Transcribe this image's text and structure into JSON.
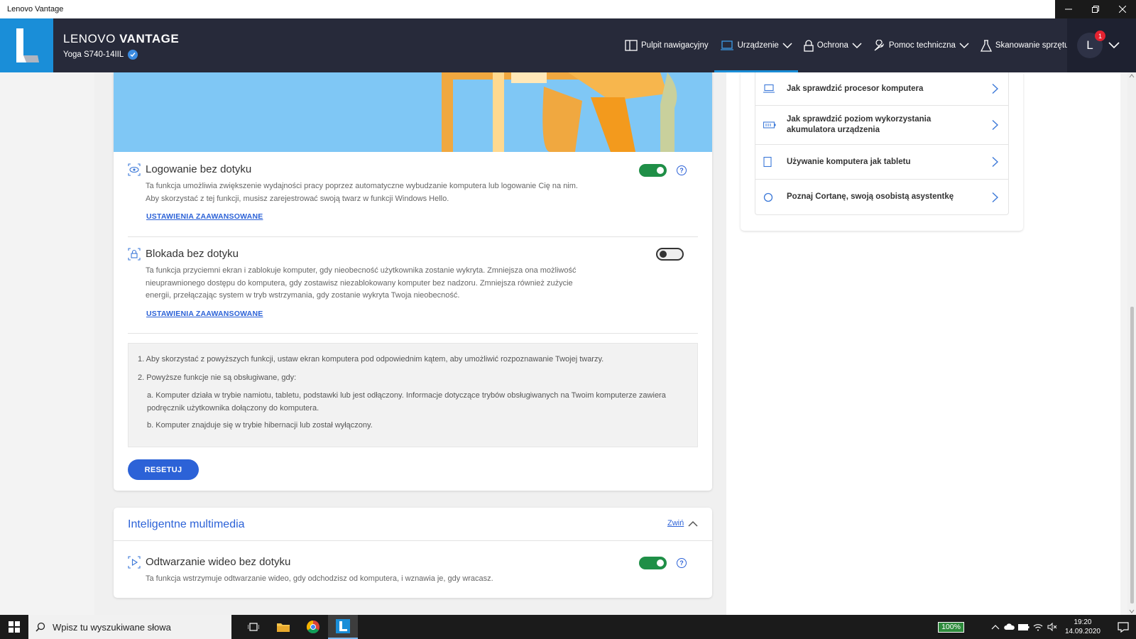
{
  "window": {
    "title": "Lenovo Vantage"
  },
  "brand": {
    "name_light": "LENOVO",
    "name_bold": "VANTAGE",
    "model": "Yoga S740-14IIL"
  },
  "nav": {
    "items": [
      {
        "label": "Pulpit nawigacyjny",
        "icon": "dashboard-icon"
      },
      {
        "label": "Urządzenie",
        "icon": "laptop-icon",
        "active": true
      },
      {
        "label": "Ochrona",
        "icon": "lock-icon"
      },
      {
        "label": "Pomoc techniczna",
        "icon": "wrench-icon"
      },
      {
        "label": "Skanowanie sprzętu",
        "icon": "flask-icon"
      }
    ],
    "user_initial": "L",
    "notification_count": "1"
  },
  "features": {
    "login": {
      "title": "Logowanie bez dotyku",
      "desc_line1": "Ta funkcja umożliwia zwiększenie wydajności pracy poprzez automatyczne wybudzanie komputera lub logowanie Cię na nim.",
      "desc_line2": "Aby skorzystać z tej funkcji, musisz zarejestrować swoją twarz w funkcji Windows Hello.",
      "link": "USTAWIENIA ZAAWANSOWANE",
      "enabled": true
    },
    "lock": {
      "title": "Blokada bez dotyku",
      "desc_line1": "Ta funkcja przyciemni ekran i zablokuje komputer, gdy nieobecność użytkownika zostanie wykryta. Zmniejsza ona możliwość",
      "desc_line2": "nieuprawnionego dostępu do komputera, gdy zostawisz niezablokowany komputer bez nadzoru. Zmniejsza również zużycie",
      "desc_line3": "energii, przełączając system w tryb wstrzymania, gdy zostanie wykryta Twoja nieobecność.",
      "link": "USTAWIENIA ZAAWANSOWANE",
      "enabled": false
    },
    "help_symbol": "?"
  },
  "notes": {
    "n1": "1. Aby skorzystać z powyższych funkcji, ustaw ekran komputera pod odpowiednim kątem, aby umożliwić rozpoznawanie Twojej twarzy.",
    "n2": "2. Powyższe funkcje nie są obsługiwane, gdy:",
    "na_line1": "a. Komputer działa w trybie namiotu, tabletu, podstawki lub jest odłączony. Informacje dotyczące trybów obsługiwanych na Twoim komputerze zawiera",
    "na_line2": "podręcznik użytkownika dołączony do komputera.",
    "nb": "b. Komputer znajduje się w trybie hibernacji lub został wyłączony."
  },
  "reset_label": "RESETUJ",
  "media": {
    "title": "Inteligentne multimedia",
    "collapse_label": "Zwiń",
    "video": {
      "title": "Odtwarzanie wideo bez dotyku",
      "desc": "Ta funkcja wstrzymuje odtwarzanie wideo, gdy odchodzisz od komputera, i wznawia je, gdy wracasz.",
      "enabled": true
    }
  },
  "articles": [
    {
      "label": "Jak sprawdzić procesor komputera",
      "icon": "laptop-icon"
    },
    {
      "label_line1": "Jak sprawdzić poziom wykorzystania",
      "label_line2": "akumulatora urządzenia",
      "icon": "battery-icon"
    },
    {
      "label": "Używanie komputera jak tabletu",
      "icon": "tablet-icon"
    },
    {
      "label": "Poznaj Cortanę, swoją osobistą asystentkę",
      "icon": "cortana-icon"
    }
  ],
  "taskbar": {
    "search_placeholder": "Wpisz tu wyszukiwane słowa",
    "battery": "100%",
    "time": "19:20",
    "date": "14.09.2020"
  }
}
